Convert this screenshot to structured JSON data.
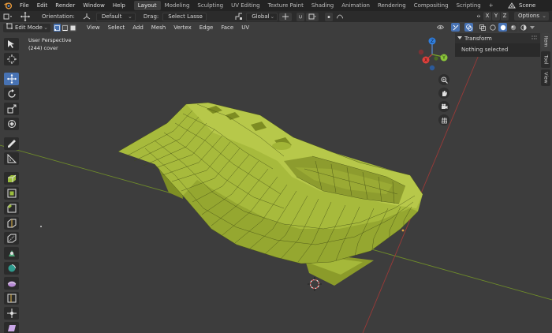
{
  "topbar": {
    "menus": [
      "File",
      "Edit",
      "Render",
      "Window",
      "Help"
    ],
    "workspaces": [
      "Layout",
      "Modeling",
      "Sculpting",
      "UV Editing",
      "Texture Paint",
      "Shading",
      "Animation",
      "Rendering",
      "Compositing",
      "Scripting"
    ],
    "active_workspace": "Layout",
    "add_workspace": "+",
    "scene_name": "Scene"
  },
  "tool_settings": {
    "orientation_label": "Orientation:",
    "orientation_value": "Default",
    "drag_label": "Drag:",
    "drag_value": "Select Lasso",
    "transform_orientation": "Global",
    "axes": [
      "X",
      "Y",
      "Z"
    ],
    "options_label": "Options"
  },
  "viewport_header": {
    "mode": "Edit Mode",
    "menus": [
      "View",
      "Select",
      "Add",
      "Mesh",
      "Vertex",
      "Edge",
      "Face",
      "UV"
    ]
  },
  "viewport": {
    "perspective_label": "User Perspective",
    "object_label": "(244) cover",
    "gizmo_axes": {
      "x": "X",
      "y": "Y",
      "z": "Z"
    }
  },
  "npanel": {
    "section_title": "Transform",
    "body_text": "Nothing selected",
    "tabs": [
      "Item",
      "Tool",
      "View"
    ],
    "active_tab": "Item"
  },
  "colors": {
    "accent": "#4772b3",
    "viewport_bg": "#3d3d3d",
    "mesh_fill": "#a5b83a",
    "mesh_shadow": "#7f8f24",
    "mesh_wire": "#3a4410",
    "axis_x": "#b8403c",
    "axis_y": "#7aa52a"
  },
  "icons": {
    "logo": "blender-logo-icon",
    "scene": "scene-icon",
    "tools": [
      "select-box-icon",
      "cursor-icon",
      "move-icon",
      "rotate-icon",
      "scale-icon",
      "transform-icon",
      "annotate-icon",
      "measure-icon",
      "extrude-icon",
      "inset-icon",
      "bevel-icon",
      "loop-cut-icon",
      "knife-icon",
      "poly-build-icon",
      "spin-icon",
      "smooth-icon",
      "edge-slide-icon",
      "shrink-fatten-icon",
      "shear-icon",
      "rip-icon"
    ],
    "nav": [
      "zoom-icon",
      "pan-hand-icon",
      "camera-icon",
      "grid-view-icon"
    ]
  }
}
